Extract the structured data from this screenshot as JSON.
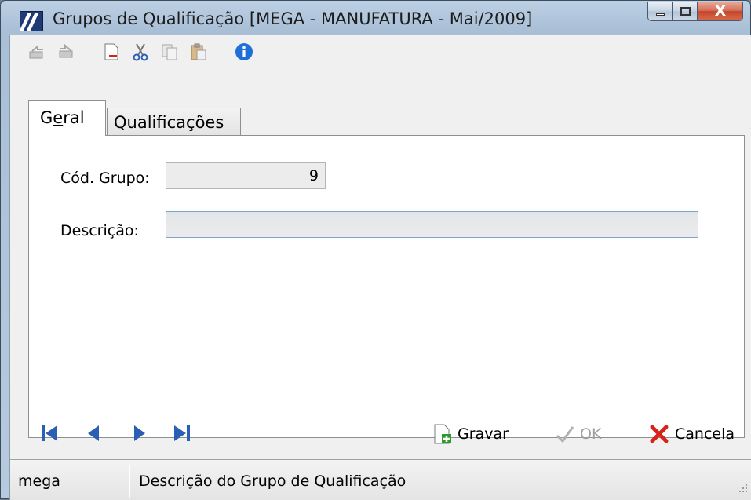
{
  "window": {
    "title": "Grupos de Qualificação [MEGA - MANUFATURA - Mai/2009]",
    "close_glyph": "X"
  },
  "toolbar": {
    "icons": [
      "undo-icon",
      "redo-icon",
      "new-document-icon",
      "cut-icon",
      "copy-icon",
      "paste-icon",
      "info-icon"
    ]
  },
  "tabs": [
    {
      "label": "Geral",
      "active": true
    },
    {
      "label": "Qualificações",
      "active": false
    }
  ],
  "form": {
    "cod_grupo_label": "Cód. Grupo:",
    "cod_grupo_value": "9",
    "descricao_label": "Descrição:",
    "descricao_value": ""
  },
  "actions": {
    "gravar": {
      "prefix": "",
      "accel": "G",
      "rest": "ravar"
    },
    "ok": {
      "accel": "O",
      "rest": "K"
    },
    "cancela": {
      "accel": "C",
      "rest": "ancela"
    }
  },
  "status": {
    "user": "mega",
    "hint": "Descrição do Grupo de Qualificação"
  },
  "colors": {
    "nav_blue": "#2b5fb3",
    "cancel_red": "#d8231b",
    "save_green": "#2d9a2d",
    "info_blue": "#1e6fd8"
  }
}
